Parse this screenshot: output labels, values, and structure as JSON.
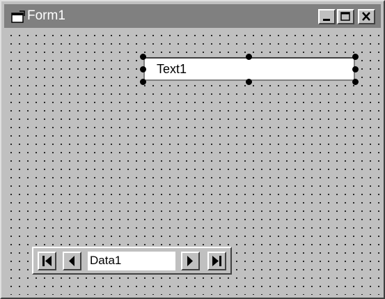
{
  "window": {
    "title": "Form1",
    "icon": "form-icon",
    "controls": [
      "minimize-icon",
      "maximize-icon",
      "close-icon"
    ]
  },
  "form": {
    "grid": "dotted",
    "textbox": {
      "value": "Text1",
      "selected": true
    },
    "data_control": {
      "caption": "Data1",
      "buttons": [
        "move-first-icon",
        "move-previous-icon",
        "move-next-icon",
        "move-last-icon"
      ]
    }
  },
  "colors": {
    "face": "#c0c0c0",
    "titlebar": "#808080",
    "title_text": "#ffffff"
  }
}
